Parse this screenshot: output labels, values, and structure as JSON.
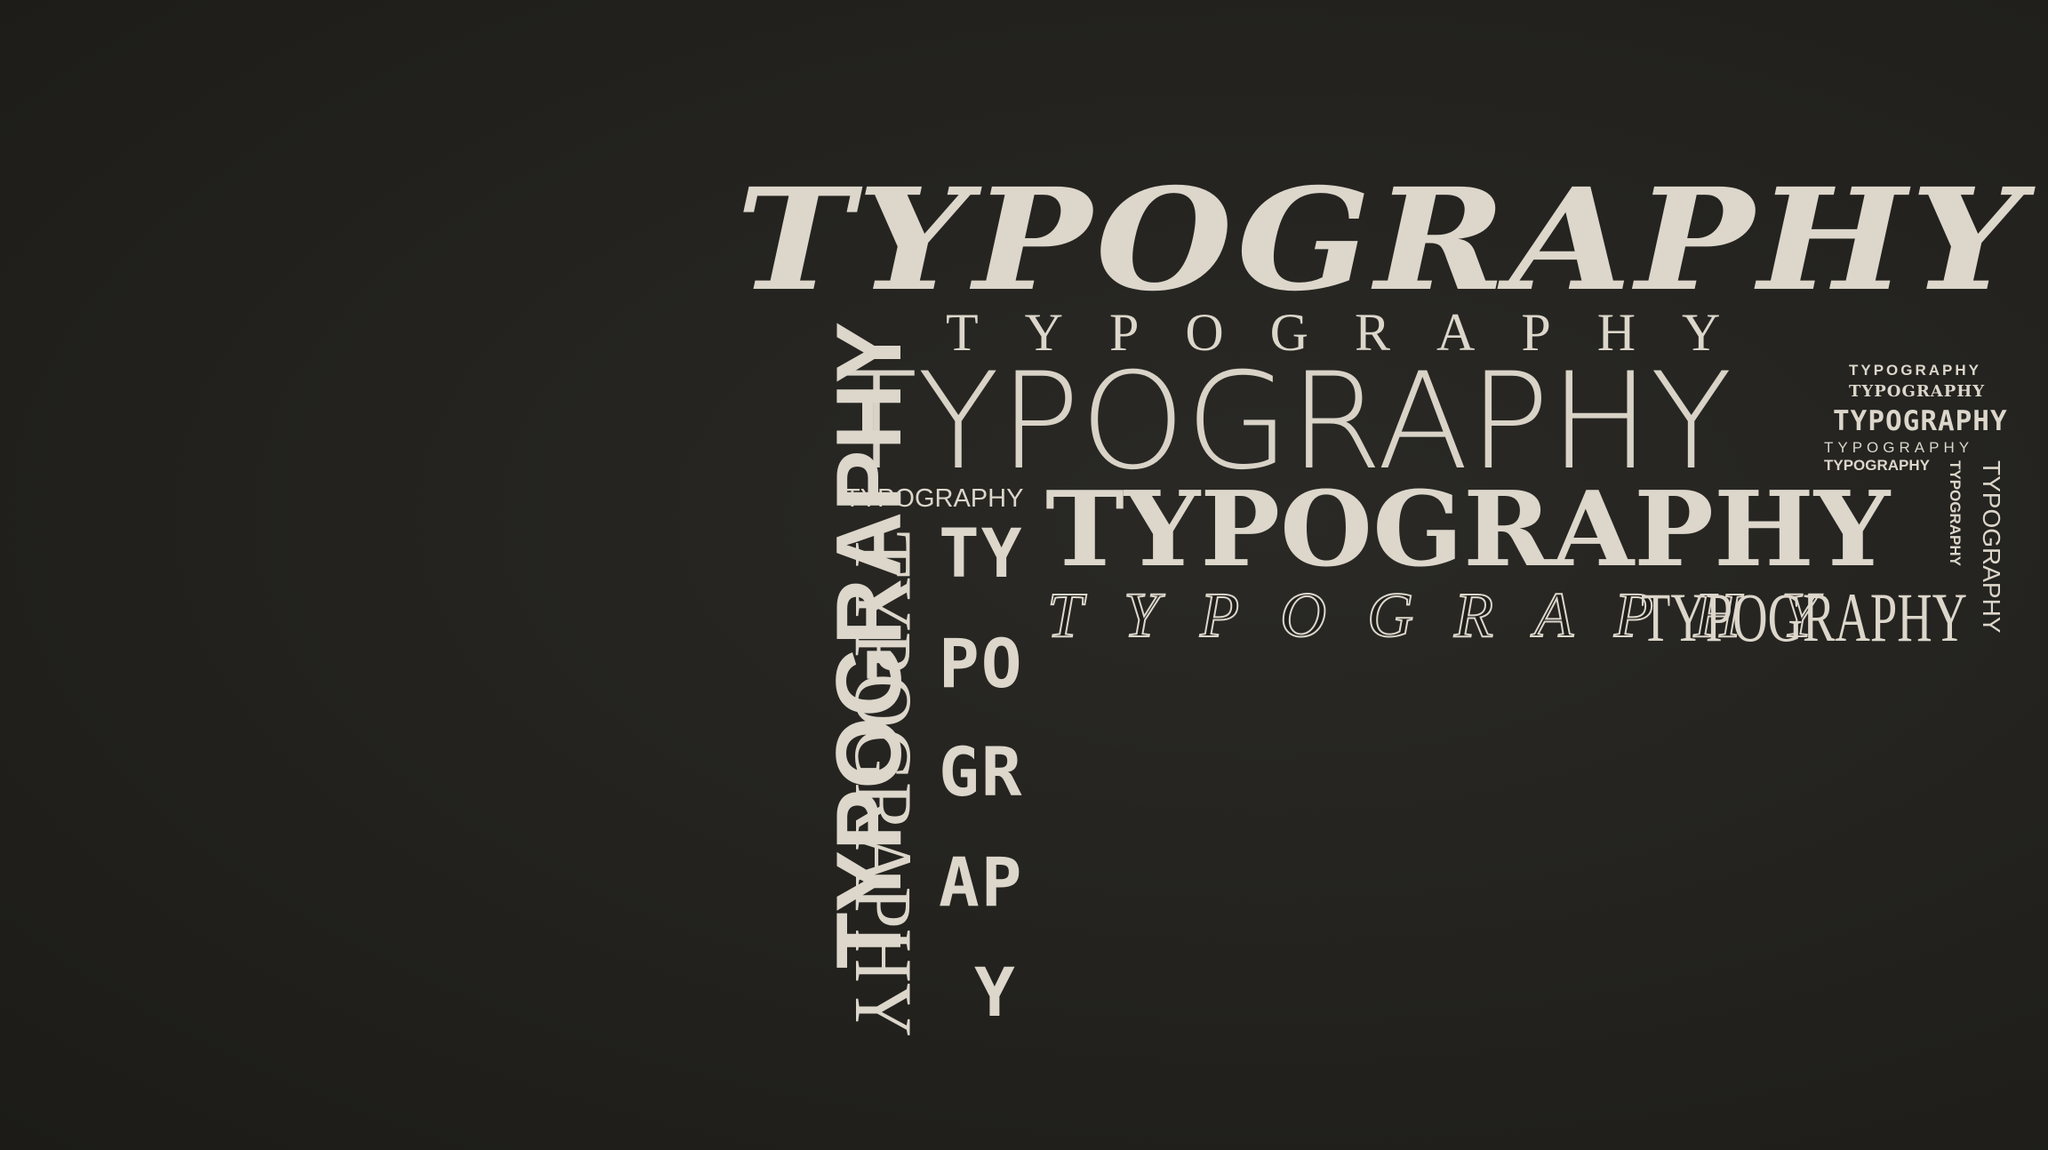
{
  "words": {
    "script": "TYPOGRAPHY",
    "spaced": "TYPOGRAPHY",
    "thin": "TYPOGRAPHY",
    "small_left": "TYPOGRAPHY",
    "bold_serif": "TYPOGRAPHY",
    "ornate": "TYPOGRAPHY",
    "condensed": "TYPOGRAPHY",
    "right_stack": [
      "TYPOGRAPHY",
      "TYPOGRAPHY",
      "TYPOGRAPHY",
      "TYPOGRAPHY",
      "TYPOGRAPHY"
    ],
    "vertical_big": "TYPOGRAPHY",
    "vertical_serif": "TYPOGRAPHY",
    "vertical_right_small": "TYPOGRAPHY",
    "vertical_right": "TYPOGRAPHY",
    "stepped": [
      "TY",
      "PO",
      "GR",
      "AP",
      "Y"
    ]
  },
  "colors": {
    "background": "#24231f",
    "text": "#dcd6cb"
  }
}
